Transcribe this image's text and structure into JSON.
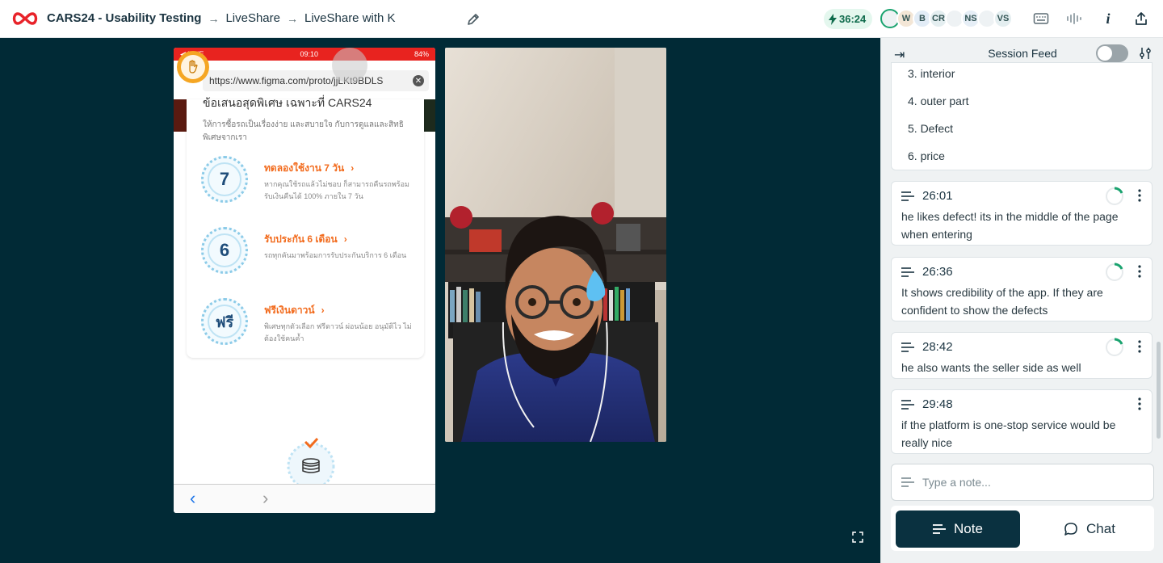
{
  "header": {
    "project": "CARS24 - Usability Testing",
    "crumb_2": "LiveShare",
    "crumb_3": "LiveShare with K",
    "separator": "→",
    "timer": "36:24",
    "avatars": [
      {
        "initials": "",
        "color": "#eef2f4"
      },
      {
        "initials": "W",
        "color": "#f3e6d6"
      },
      {
        "initials": "B",
        "color": "#e2ecf6"
      },
      {
        "initials": "CR",
        "color": "#e4eef0"
      },
      {
        "initials": "",
        "color": "#eef2f4"
      },
      {
        "initials": "NS",
        "color": "#e6eef6"
      },
      {
        "initials": "",
        "color": "#eef2f4"
      },
      {
        "initials": "VS",
        "color": "#e4eef0"
      }
    ],
    "icons": [
      "keyboard-icon",
      "waveform-icon",
      "info-icon",
      "share-icon"
    ]
  },
  "phone": {
    "status_left": "◀ LINE",
    "status_time": "09:10",
    "status_battery": "84%",
    "url": "https://www.figma.com/proto/jjLKt9BDLS",
    "promo_title": "ข้อเสนอสุดพิเศษ เฉพาะที่ CARS24",
    "promo_sub": "ให้การซื้อรถเป็นเรื่องง่าย และสบายใจ กับการดูแลและสิทธิพิเศษจากเรา",
    "benefits": [
      {
        "badge": "7",
        "title": "ทดลองใช้งาน 7 วัน",
        "desc": "หากคุณใช้รถแล้วไม่ชอบ ก็สามารถคืนรถพร้อมรับเงินคืนได้ 100% ภายใน 7 วัน"
      },
      {
        "badge": "6",
        "title": "รับประกัน 6 เดือน",
        "desc": "รถทุกคันมาพร้อมการรับประกันบริการ 6 เดือน"
      },
      {
        "badge": "ฟรี",
        "title": "ฟรีเงินดาวน์",
        "desc": "พิเศษทุกตัวเลือก ฟรีดาวน์ ผ่อนน้อย อนุมัติไว ไม่ต้องใช้คนค้ำ"
      }
    ]
  },
  "panel": {
    "title": "Session Feed",
    "list_items": [
      "3. interior",
      "4. outer part",
      "5. Defect",
      "6. price"
    ],
    "notes": [
      {
        "time": "26:01",
        "text": "he likes defect! its in the middle of the page when entering"
      },
      {
        "time": "26:36",
        "text": "It shows credibility of the app. If they are confident to show the defects"
      },
      {
        "time": "28:42",
        "text": "he also wants the seller side as well"
      },
      {
        "time": "29:48",
        "text": "if the platform is one-stop service would be really nice"
      }
    ],
    "input_placeholder": "Type a note...",
    "note_label": "Note",
    "chat_label": "Chat"
  },
  "colors": {
    "stage": "#012a36",
    "accent_dark": "#0a3140",
    "timer_bg": "#e4f7ee",
    "brand_red": "#e8231f",
    "thai_orange": "#f26b1d"
  }
}
